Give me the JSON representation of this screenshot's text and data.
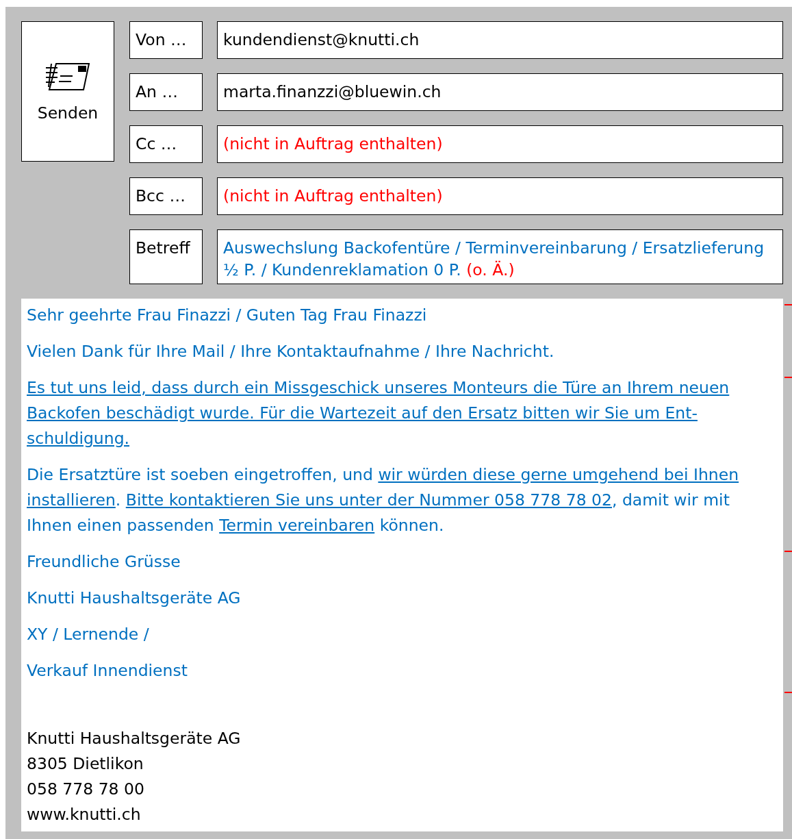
{
  "send_button": {
    "label": "Senden"
  },
  "fields": [
    {
      "label": "Von …",
      "value": [
        {
          "text": "kundendienst@knutti.ch",
          "color": "#000000"
        }
      ]
    },
    {
      "label": "An …",
      "value": [
        {
          "text": "marta.finanzzi@bluewin.ch",
          "color": "#000000"
        }
      ]
    },
    {
      "label": "Cc …",
      "value": [
        {
          "text": "(nicht in Auftrag enthalten)",
          "color": "#ff0000"
        }
      ]
    },
    {
      "label": "Bcc …",
      "value": [
        {
          "text": "(nicht in Auftrag enthalten)",
          "color": "#ff0000"
        }
      ]
    },
    {
      "label": "Betreff",
      "value": [
        {
          "text": "Auswechslung Backofentüre / Terminvereinbarung / Ersatzlieferung ½ P. / Kundenreklamation 0 P.",
          "color": "#0070c0"
        },
        {
          "text": "(o. Ä.)",
          "color": "#ff0000"
        }
      ]
    }
  ],
  "body": [
    {
      "paragraphs": [
        [
          {
            "text": "Sehr geehrte Frau Finazzi / Guten Tag Frau Finazzi",
            "underlined": false
          }
        ],
        [
          {
            "text": "Vielen Dank für Ihre Mail / Ihre Kontaktaufnahme / Ihre Nachricht.",
            "underlined": false
          }
        ]
      ]
    },
    {
      "paragraphs": [
        [
          {
            "text": "Es tut uns leid, dass durch ein Missgeschick unseres Monteurs die Türe an Ihrem neuen Backofen beschädigt wurde. Für die Wartezeit auf den Ersatz bitten wir Sie um Ent-schuldigung.",
            "underlined": true
          }
        ],
        [
          {
            "text": "Die Ersatztüre ist soeben eingetroffen, und ",
            "underlined": false
          },
          {
            "text": "wir würden diese gerne umgehend bei Ihnen installieren",
            "underlined": true
          },
          {
            "text": ". ",
            "underlined": false
          },
          {
            "text": "Bitte kontaktieren Sie uns unter der Nummer 058 778 78 02",
            "underlined": true
          },
          {
            "text": ", damit wir mit Ihnen einen passenden ",
            "underlined": false
          },
          {
            "text": "Termin vereinbaren",
            "underlined": true
          },
          {
            "text": " können.",
            "underlined": false
          }
        ]
      ]
    },
    {
      "paragraphs": [
        [
          {
            "text": "Freundliche Grüsse",
            "underlined": false
          }
        ],
        [
          {
            "text": "Knutti Haushaltsgeräte AG",
            "underlined": false
          }
        ],
        [
          {
            "text": "XY / Lernende /",
            "underlined": false
          }
        ],
        [
          {
            "text": "Verkauf Innendienst",
            "underlined": false
          }
        ]
      ]
    }
  ],
  "signature": [
    "Knutti Haushaltsgeräte AG",
    "8305 Dietlikon",
    "058 778 78 00",
    "www.knutti.ch"
  ]
}
